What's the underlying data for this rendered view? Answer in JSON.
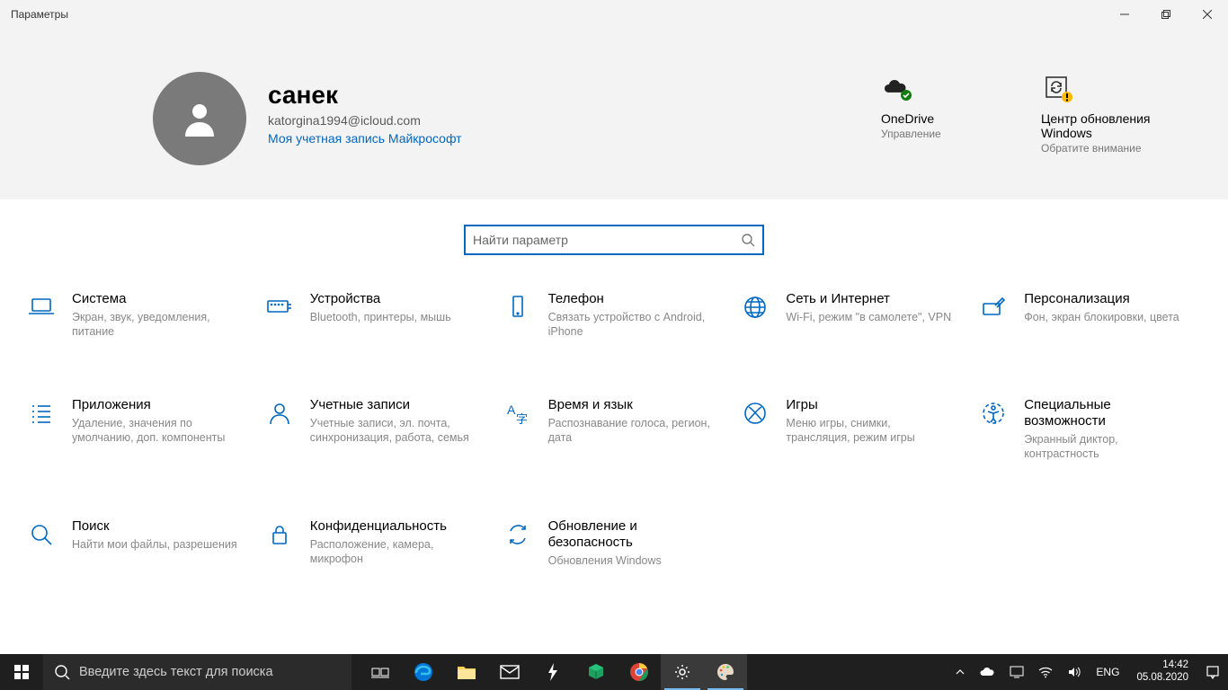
{
  "window": {
    "title": "Параметры"
  },
  "profile": {
    "name": "санек",
    "email": "katorgina1994@icloud.com",
    "link": "Моя учетная запись Майкрософт"
  },
  "header_tiles": {
    "onedrive": {
      "title": "OneDrive",
      "sub": "Управление"
    },
    "update": {
      "title": "Центр обновления Windows",
      "sub": "Обратите внимание"
    }
  },
  "search": {
    "placeholder": "Найти параметр"
  },
  "categories": [
    {
      "title": "Система",
      "desc": "Экран, звук, уведомления, питание"
    },
    {
      "title": "Устройства",
      "desc": "Bluetooth, принтеры, мышь"
    },
    {
      "title": "Телефон",
      "desc": "Связать устройство с Android, iPhone"
    },
    {
      "title": "Сеть и Интернет",
      "desc": "Wi-Fi, режим \"в самолете\", VPN"
    },
    {
      "title": "Персонализация",
      "desc": "Фон, экран блокировки, цвета"
    },
    {
      "title": "Приложения",
      "desc": "Удаление, значения по умолчанию, доп. компоненты"
    },
    {
      "title": "Учетные записи",
      "desc": "Учетные записи, эл. почта, синхронизация, работа, семья"
    },
    {
      "title": "Время и язык",
      "desc": "Распознавание голоса, регион, дата"
    },
    {
      "title": "Игры",
      "desc": "Меню игры, снимки, трансляция, режим игры"
    },
    {
      "title": "Специальные возможности",
      "desc": "Экранный диктор, контрастность"
    },
    {
      "title": "Поиск",
      "desc": "Найти мои файлы, разрешения"
    },
    {
      "title": "Конфиденциальность",
      "desc": "Расположение, камера, микрофон"
    },
    {
      "title": "Обновление и безопасность",
      "desc": "Обновления Windows"
    }
  ],
  "taskbar": {
    "search_placeholder": "Введите здесь текст для поиска",
    "lang": "ENG",
    "time": "14:42",
    "date": "05.08.2020"
  }
}
